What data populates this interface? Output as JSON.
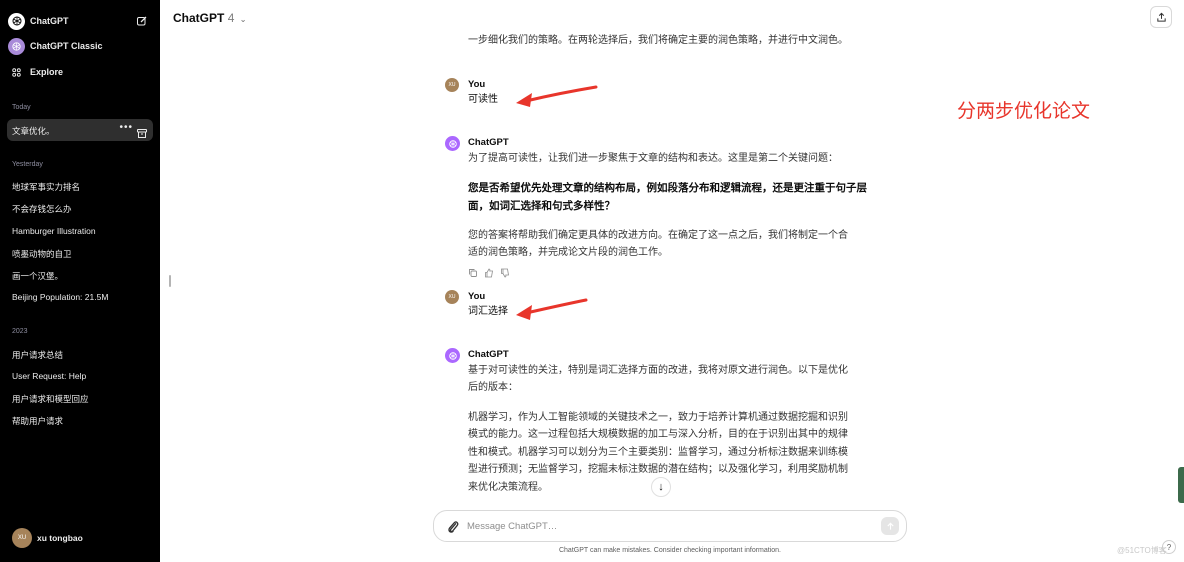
{
  "sidebar": {
    "chatgpt_label": "ChatGPT",
    "classic_label": "ChatGPT Classic",
    "explore_label": "Explore",
    "sections": {
      "today": "Today",
      "yesterday": "Yesterday",
      "y2023": "2023"
    },
    "today_items": [
      {
        "label": "文章优化。"
      }
    ],
    "active_dots": "•••",
    "yesterday_items": [
      {
        "label": "地球军事实力排名"
      },
      {
        "label": "不会存钱怎么办"
      },
      {
        "label": "Hamburger Illustration"
      },
      {
        "label": "喷墨动物的自卫"
      },
      {
        "label": "画一个汉堡。"
      },
      {
        "label": "Beijing Population: 21.5M"
      }
    ],
    "y2023_items": [
      {
        "label": "用户请求总结"
      },
      {
        "label": "User Request: Help"
      },
      {
        "label": "用户请求和模型回应"
      },
      {
        "label": "帮助用户请求"
      }
    ],
    "user": {
      "initials": "XU",
      "name": "xu tongbao"
    }
  },
  "header": {
    "model_name": "ChatGPT",
    "model_version": "4",
    "chevron": "⌄"
  },
  "chat": {
    "top_fragment": "一步细化我们的策略。在两轮选择后，我们将确定主要的润色策略，并进行中文润色。",
    "user_initials": "XU",
    "user_name": "You",
    "gpt_name": "ChatGPT",
    "msg1_user": "可读性",
    "msg2_gpt_intro": "为了提高可读性，让我们进一步聚焦于文章的结构和表达。这里是第二个关键问题：",
    "msg2_gpt_bold_line1": "您是否希望优先处理文章的结构布局，例如段落分布和逻辑流程，还是更注重于句子层",
    "msg2_gpt_bold_line2": "面，如词汇选择和句式多样性？",
    "msg2_gpt_outro_line1": "您的答案将帮助我们确定更具体的改进方向。在确定了这一点之后，我们将制定一个合",
    "msg2_gpt_outro_line2": "适的润色策略，并完成论文片段的润色工作。",
    "msg3_user": "词汇选择",
    "msg4_gpt_intro_line1": "基于对可读性的关注，特别是词汇选择方面的改进，我将对原文进行润色。以下是优化",
    "msg4_gpt_intro_line2": "后的版本：",
    "msg4_gpt_body": [
      "机器学习，作为人工智能领域的关键技术之一，致力于培养计算机通过数据挖掘和识别",
      "模式的能力。这一过程包括大规模数据的加工与深入分析，目的在于识别出其中的规律",
      "性和模式。机器学习可以划分为三个主要类别：监督学习，通过分析标注数据来训练模",
      "型进行预测；无监督学习，挖掘未标注数据的潜在结构；以及强化学习，利用奖励机制",
      "来优化决策流程。"
    ]
  },
  "annotation": {
    "text": "分两步优化论文",
    "color": "#e8352b"
  },
  "composer": {
    "placeholder": "Message ChatGPT…",
    "disclaimer": "ChatGPT can make mistakes. Consider checking important information."
  },
  "misc": {
    "help": "?",
    "scroll_down": "↓",
    "watermark": "@51CTO博客"
  },
  "colors": {
    "sidebar_bg": "#000000",
    "active_item_bg": "#2f2f2f",
    "gpt_avatar": "#ab68ff",
    "user_avatar": "#a6835a"
  }
}
